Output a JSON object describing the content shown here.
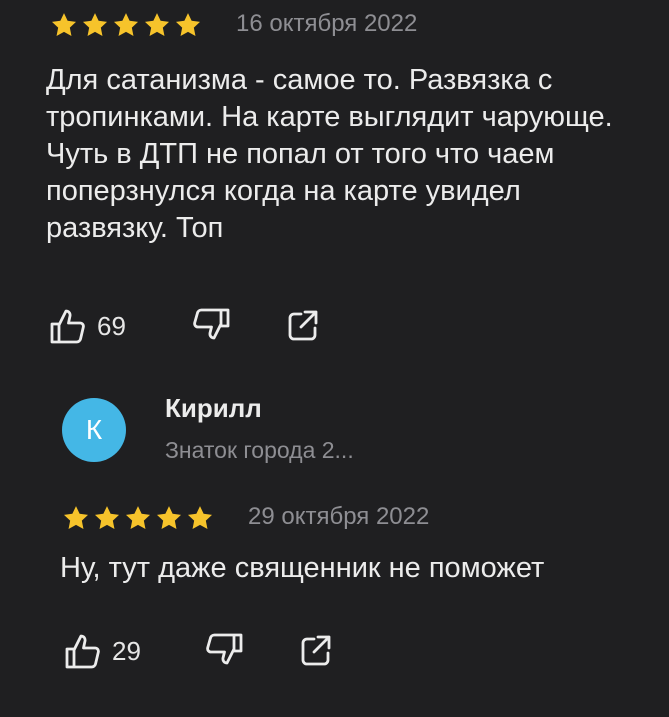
{
  "review1": {
    "rating": 5,
    "date": "16 октября 2022",
    "text": "Для сатанизма - самое то. Развязка с тропинками. На карте выглядит чарующе. Чуть в ДТП не попал от того что чаем поперзнулся когда на карте увидел развязку. Топ",
    "likes": "69",
    "icons": [
      "thumbs-up-icon",
      "thumbs-down-icon",
      "share-icon"
    ]
  },
  "review2": {
    "author": {
      "initial": "К",
      "name": "Кирилл",
      "subtitle": "Знаток города 2..."
    },
    "rating": 5,
    "date": "29 октября 2022",
    "text": "Ну, тут даже священник не поможет",
    "likes": "29",
    "icons": [
      "thumbs-up-icon",
      "thumbs-down-icon",
      "share-icon"
    ]
  },
  "colors": {
    "background": "#1f1f21",
    "star": "#f6c32b",
    "avatar": "#44b7e6",
    "muted_text": "#8e8e93"
  }
}
